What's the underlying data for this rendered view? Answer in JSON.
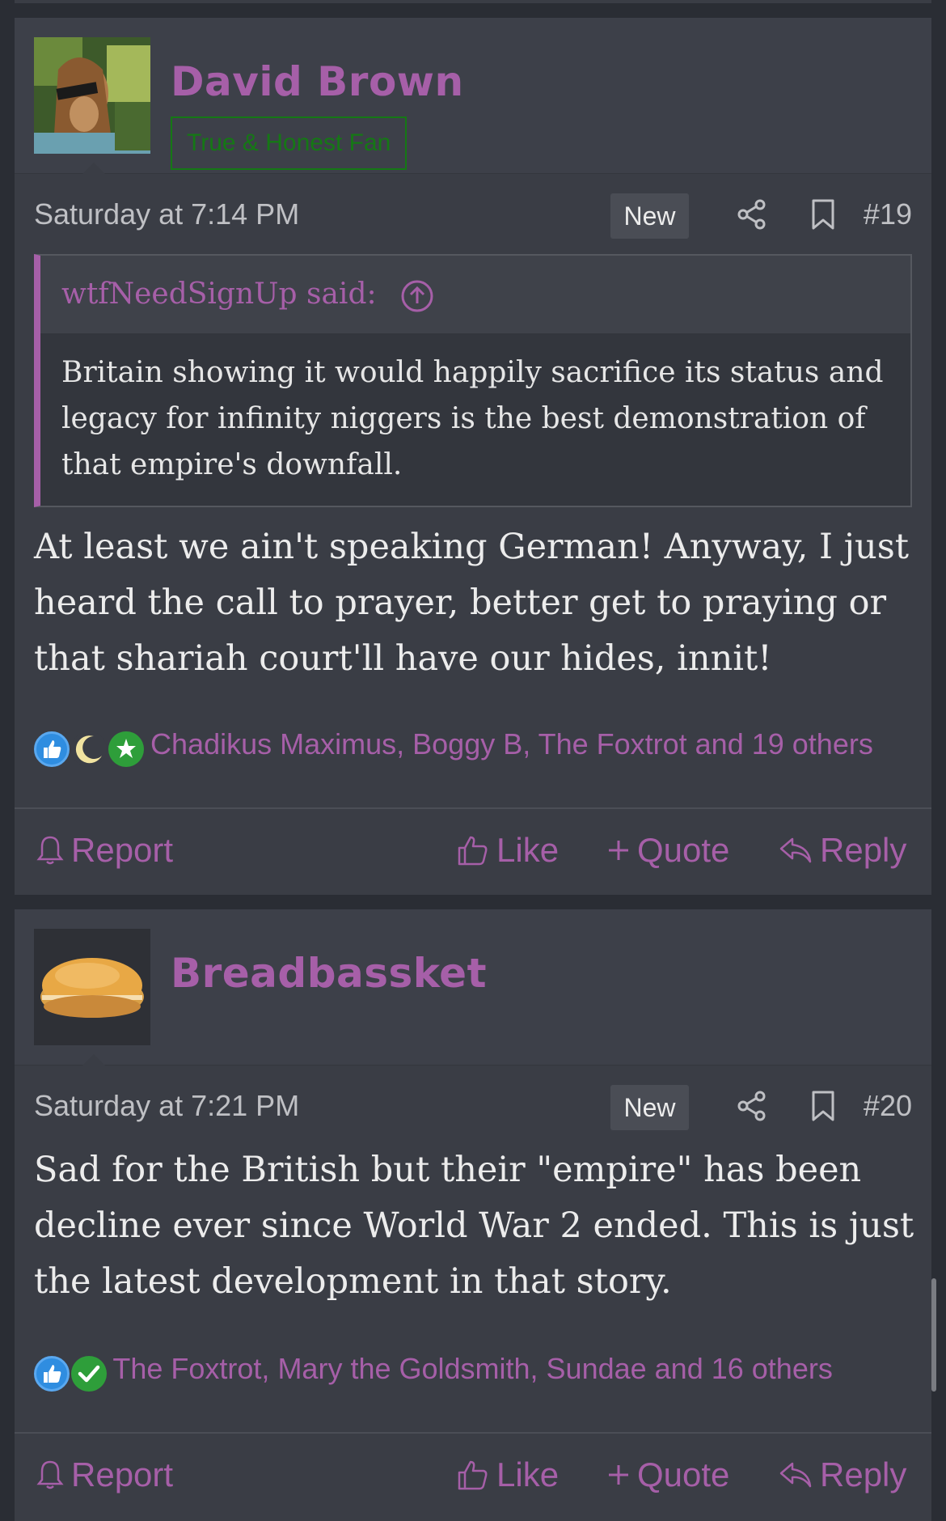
{
  "colors": {
    "accent": "#a65fa8",
    "background": "#2a2d34",
    "panel": "#3a3d45",
    "user_title_green": "#157815"
  },
  "posts": [
    {
      "username": "David Brown",
      "user_title": "True & Honest Fan",
      "avatar_icon": "user-avatar",
      "date": "Saturday at 7:14 PM",
      "badge": "New",
      "post_number": "#19",
      "quote": {
        "author": "wtfNeedSignUp said:",
        "text": "Britain showing it would happily sacrifice its status and legacy for infinity niggers is the best demonstration of that empire's downfall."
      },
      "message": "At least we ain't speaking German! Anyway, I just heard the call to prayer, better get to praying or that shariah court'll have our hides, innit!",
      "reactions_text": "Chadikus Maximus, Boggy B, The Foxtrot and 19 others",
      "reaction_icons": [
        "thumbs-up-icon",
        "moon-icon",
        "star-icon"
      ],
      "actions": {
        "report": "Report",
        "like": "Like",
        "quote": "Quote",
        "reply": "Reply"
      }
    },
    {
      "username": "Breadbassket",
      "avatar_icon": "bread-bun-avatar",
      "date": "Saturday at 7:21 PM",
      "badge": "New",
      "post_number": "#20",
      "message": "Sad for the British but their \"empire\" has been decline ever since World War 2 ended. This is just the latest development in that story.",
      "reactions_text": "The Foxtrot, Mary the Goldsmith, Sundae and 16 others",
      "reaction_icons": [
        "thumbs-up-icon",
        "checkmark-icon"
      ],
      "actions": {
        "report": "Report",
        "like": "Like",
        "quote": "Quote",
        "reply": "Reply"
      }
    }
  ]
}
